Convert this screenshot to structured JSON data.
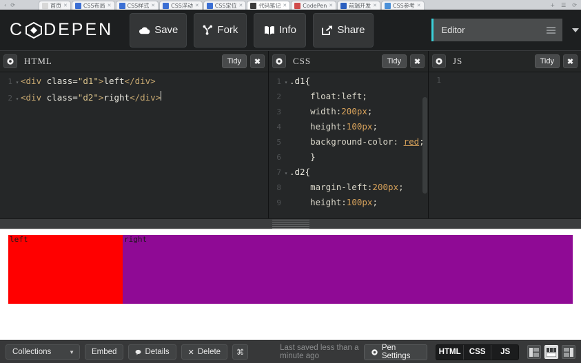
{
  "browser": {
    "tabs": [
      {
        "title": "首页",
        "fav": "#d8d8d8",
        "active": false
      },
      {
        "title": "CSS布局",
        "fav": "#3b6fd4",
        "active": false
      },
      {
        "title": "CSS样式",
        "fav": "#3b6fd4",
        "active": false
      },
      {
        "title": "CSS浮动",
        "fav": "#3b6fd4",
        "active": false
      },
      {
        "title": "CSS定位",
        "fav": "#3b6fd4",
        "active": false
      },
      {
        "title": "代码笔记",
        "fav": "#3a3a3a",
        "active": true
      },
      {
        "title": "CodePen",
        "fav": "#d04b4b",
        "active": false
      },
      {
        "title": "前端开发",
        "fav": "#2b5fc0",
        "active": false
      },
      {
        "title": "CSS参考",
        "fav": "#4a90d9",
        "active": false
      }
    ],
    "end_icons": [
      "+",
      "☰",
      "⟳"
    ]
  },
  "header": {
    "logo_left": "C",
    "logo_right": "DEPEN",
    "logo_mark_icon": "codepen-diamond-icon",
    "buttons": [
      {
        "label": "Save",
        "icon": "cloud-icon"
      },
      {
        "label": "Fork",
        "icon": "fork-icon"
      },
      {
        "label": "Info",
        "icon": "info-book-icon"
      },
      {
        "label": "Share",
        "icon": "share-box-icon"
      }
    ],
    "view_select": {
      "value": "Editor",
      "accent_color": "#3ad1da",
      "menu_icon": "hamburger-icon"
    },
    "caret_icon": "chevron-down-icon",
    "power_icon": "power-icon",
    "power_color": "#1a7fd4"
  },
  "panes": [
    {
      "name": "html",
      "title": "HTML",
      "gear_icon": "gear-icon",
      "tidy_label": "Tidy",
      "close_label": "✖",
      "lines": [
        {
          "n": "1",
          "fold": "▾",
          "tokens": [
            {
              "t": "<div ",
              "c": "tok-tag"
            },
            {
              "t": "class=",
              "c": "tok-attr"
            },
            {
              "t": "\"d1\"",
              "c": "tok-str"
            },
            {
              "t": ">",
              "c": "tok-tag"
            },
            {
              "t": "left",
              "c": "tok-txt"
            },
            {
              "t": "</div>",
              "c": "tok-tag"
            }
          ]
        },
        {
          "n": "2",
          "fold": "▾",
          "tokens": [
            {
              "t": "<div ",
              "c": "tok-tag"
            },
            {
              "t": "class=",
              "c": "tok-attr"
            },
            {
              "t": "\"d2\"",
              "c": "tok-str"
            },
            {
              "t": ">",
              "c": "tok-tag"
            },
            {
              "t": "right",
              "c": "tok-txt"
            },
            {
              "t": "</div>",
              "c": "tok-tag"
            }
          ],
          "caret": true
        }
      ]
    },
    {
      "name": "css",
      "title": "CSS",
      "gear_icon": "gear-icon",
      "tidy_label": "Tidy",
      "close_label": "✖",
      "lines": [
        {
          "n": "1",
          "fold": "▾",
          "tokens": [
            {
              "t": ".d1{",
              "c": "tok-sel"
            }
          ]
        },
        {
          "n": "2",
          "fold": "",
          "tokens": [
            {
              "t": "    float:",
              "c": "tok-prop"
            },
            {
              "t": "left",
              "c": "tok-kw"
            },
            {
              "t": ";",
              "c": "tok-prop"
            }
          ]
        },
        {
          "n": "3",
          "fold": "",
          "tokens": [
            {
              "t": "    width:",
              "c": "tok-prop"
            },
            {
              "t": "200px",
              "c": "tok-num"
            },
            {
              "t": ";",
              "c": "tok-prop"
            }
          ]
        },
        {
          "n": "4",
          "fold": "",
          "tokens": [
            {
              "t": "    height:",
              "c": "tok-prop"
            },
            {
              "t": "100px",
              "c": "tok-num"
            },
            {
              "t": ";",
              "c": "tok-prop"
            }
          ]
        },
        {
          "n": "5",
          "fold": "",
          "tokens": [
            {
              "t": "    background-color: ",
              "c": "tok-prop"
            },
            {
              "t": "red",
              "c": "tok-red"
            },
            {
              "t": ";",
              "c": "tok-prop"
            }
          ]
        },
        {
          "n": "6",
          "fold": "",
          "tokens": [
            {
              "t": "    }",
              "c": "tok-sel"
            }
          ]
        },
        {
          "n": "7",
          "fold": "▾",
          "tokens": [
            {
              "t": ".d2{",
              "c": "tok-sel"
            }
          ]
        },
        {
          "n": "8",
          "fold": "",
          "tokens": [
            {
              "t": "    margin-left:",
              "c": "tok-prop"
            },
            {
              "t": "200px",
              "c": "tok-num"
            },
            {
              "t": ";",
              "c": "tok-prop"
            }
          ]
        },
        {
          "n": "9",
          "fold": "",
          "tokens": [
            {
              "t": "    height:",
              "c": "tok-prop"
            },
            {
              "t": "100px",
              "c": "tok-num"
            },
            {
              "t": ";",
              "c": "tok-prop"
            }
          ]
        }
      ]
    },
    {
      "name": "js",
      "title": "JS",
      "gear_icon": "gear-icon",
      "tidy_label": "Tidy",
      "close_label": "✖",
      "lines": [
        {
          "n": "1",
          "fold": "",
          "tokens": [
            {
              "t": "",
              "c": "ctext"
            }
          ]
        }
      ]
    }
  ],
  "preview": {
    "left_box": {
      "text": "left",
      "color": "#ff0000"
    },
    "right_box": {
      "text": "right",
      "color": "#8f0a95"
    }
  },
  "bottombar": {
    "collections_label": "Collections",
    "collections_caret": "▼",
    "embed_label": "Embed",
    "details_label": "Details",
    "details_icon": "comment-icon",
    "delete_label": "Delete",
    "delete_icon": "x-icon",
    "keyboard_icon": "⌘",
    "saved_text": "Last saved less than a minute ago",
    "pen_settings_label": "Pen Settings",
    "pen_settings_icon": "gear-icon",
    "segments": [
      "HTML",
      "CSS",
      "JS"
    ],
    "layout_buttons": [
      {
        "name": "layout-left",
        "active": false
      },
      {
        "name": "layout-top",
        "active": true
      },
      {
        "name": "layout-right",
        "active": false
      }
    ]
  }
}
